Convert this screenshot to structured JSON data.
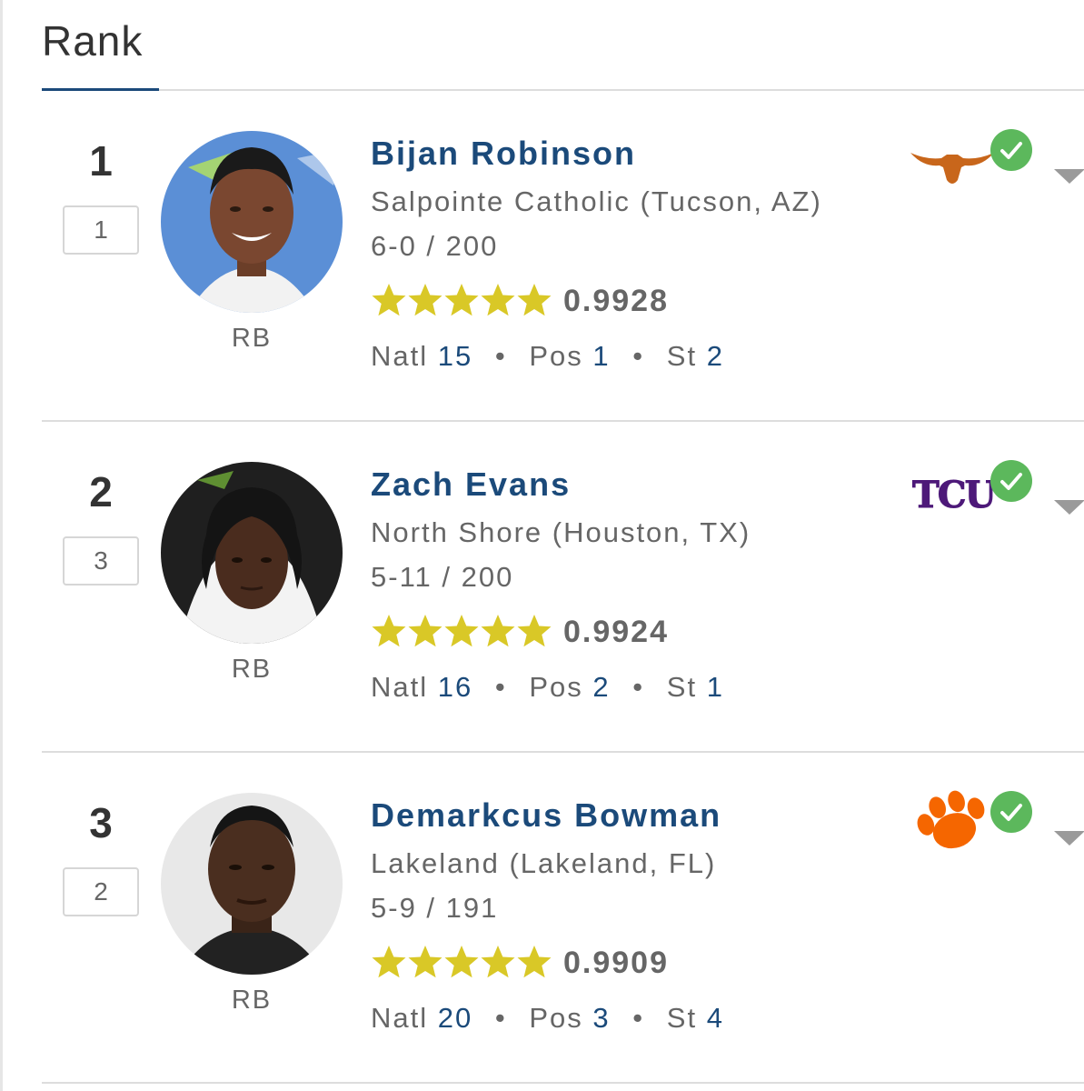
{
  "header": {
    "tab_label": "Rank"
  },
  "separator": "•",
  "players": [
    {
      "rank": "1",
      "previous_rank": "1",
      "name": "Bijan Robinson",
      "school": "Salpointe Catholic (Tucson, AZ)",
      "height_weight": "6-0 / 200",
      "position": "RB",
      "stars": 5,
      "rating": "0.9928",
      "natl_label": "Natl",
      "natl_rank": "15",
      "pos_label": "Pos",
      "pos_rank": "1",
      "st_label": "St",
      "st_rank": "2",
      "team_logo": "texas-longhorn-logo",
      "committed": true,
      "photo_bg": "#5b8fd6"
    },
    {
      "rank": "2",
      "previous_rank": "3",
      "name": "Zach Evans",
      "school": "North Shore (Houston, TX)",
      "height_weight": "5-11 / 200",
      "position": "RB",
      "stars": 5,
      "rating": "0.9924",
      "natl_label": "Natl",
      "natl_rank": "16",
      "pos_label": "Pos",
      "pos_rank": "2",
      "st_label": "St",
      "st_rank": "1",
      "team_logo": "tcu-logo",
      "team_logo_text": "TCU",
      "committed": true,
      "photo_bg": "#1f1f1f"
    },
    {
      "rank": "3",
      "previous_rank": "2",
      "name": "Demarkcus Bowman",
      "school": "Lakeland (Lakeland, FL)",
      "height_weight": "5-9 / 191",
      "position": "RB",
      "stars": 5,
      "rating": "0.9909",
      "natl_label": "Natl",
      "natl_rank": "20",
      "pos_label": "Pos",
      "pos_rank": "3",
      "st_label": "St",
      "st_rank": "4",
      "team_logo": "clemson-paw-logo",
      "committed": true,
      "photo_bg": "#e8e8e8"
    }
  ],
  "colors": {
    "name_blue": "#1b4a7a",
    "star_yellow": "#d9c827",
    "check_green": "#5cb85c",
    "texas_orange": "#c8661b",
    "tcu_purple": "#4d1979",
    "clemson_orange": "#f56600"
  }
}
